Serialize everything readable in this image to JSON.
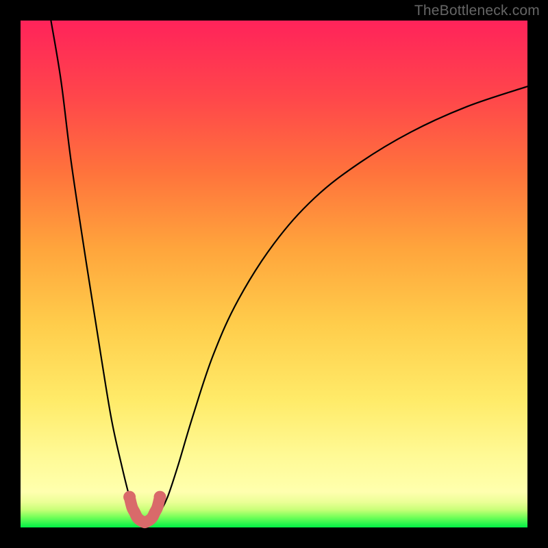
{
  "watermark": "TheBottleneck.com",
  "chart_data": {
    "type": "line",
    "title": "",
    "xlabel": "",
    "ylabel": "",
    "xlim": [
      0,
      100
    ],
    "ylim": [
      0,
      100
    ],
    "background_gradient": {
      "top_color": "#ff2a5a",
      "bottom_color": "#00f046",
      "stops": [
        "red",
        "orange",
        "yellow",
        "green"
      ]
    },
    "series": [
      {
        "name": "bottleneck-curve",
        "color": "#000000",
        "x": [
          6.0,
          8.0,
          10.0,
          13.0,
          16.0,
          18.0,
          20.0,
          21.5,
          22.5,
          23.5,
          24.5,
          25.5,
          26.5,
          27.5,
          29.0,
          31.0,
          34.0,
          38.0,
          43.0,
          50.0,
          58.0,
          67.0,
          77.0,
          88.0,
          100.0
        ],
        "values": [
          100.0,
          88.0,
          72.0,
          52.0,
          33.0,
          21.0,
          12.0,
          6.0,
          3.0,
          1.5,
          1.0,
          1.0,
          1.5,
          3.0,
          6.0,
          12.0,
          22.0,
          34.0,
          45.0,
          56.0,
          65.0,
          72.0,
          78.0,
          83.0,
          87.0
        ]
      },
      {
        "name": "marker-band",
        "color": "#d96a6a",
        "x": [
          21.5,
          22.0,
          22.5,
          23.0,
          23.5,
          24.0,
          24.5,
          25.0,
          25.5,
          26.0,
          26.5,
          27.0,
          27.5
        ],
        "values": [
          6.0,
          4.0,
          3.0,
          2.0,
          1.5,
          1.2,
          1.0,
          1.2,
          1.5,
          2.0,
          3.0,
          4.0,
          6.0
        ]
      }
    ]
  }
}
